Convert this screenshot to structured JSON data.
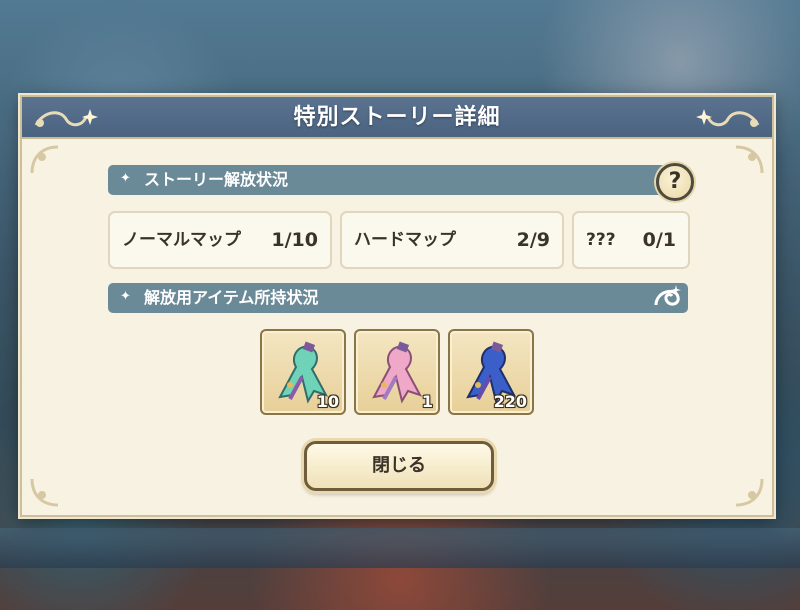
{
  "dialog": {
    "title": "特別ストーリー詳細"
  },
  "story_section": {
    "label": "ストーリー解放状況",
    "help_label": "?",
    "maps": [
      {
        "name": "ノーマルマップ",
        "progress": "1/10"
      },
      {
        "name": "ハードマップ",
        "progress": "2/9"
      },
      {
        "name": "???",
        "progress": "0/1"
      }
    ]
  },
  "item_section": {
    "label": "解放用アイテム所持状況",
    "items": [
      {
        "icon": "ribbon-teal-icon",
        "quantity": "10",
        "color": "#6fd3b8"
      },
      {
        "icon": "ribbon-pink-icon",
        "quantity": "1",
        "color": "#f0a8c8"
      },
      {
        "icon": "ribbon-blue-icon",
        "quantity": "220",
        "color": "#3a5fc8"
      }
    ]
  },
  "close_button": {
    "label": "閉じる"
  },
  "colors": {
    "header": "#4f6884",
    "section_bar": "#6b8a98",
    "panel": "#f7f2e2"
  }
}
